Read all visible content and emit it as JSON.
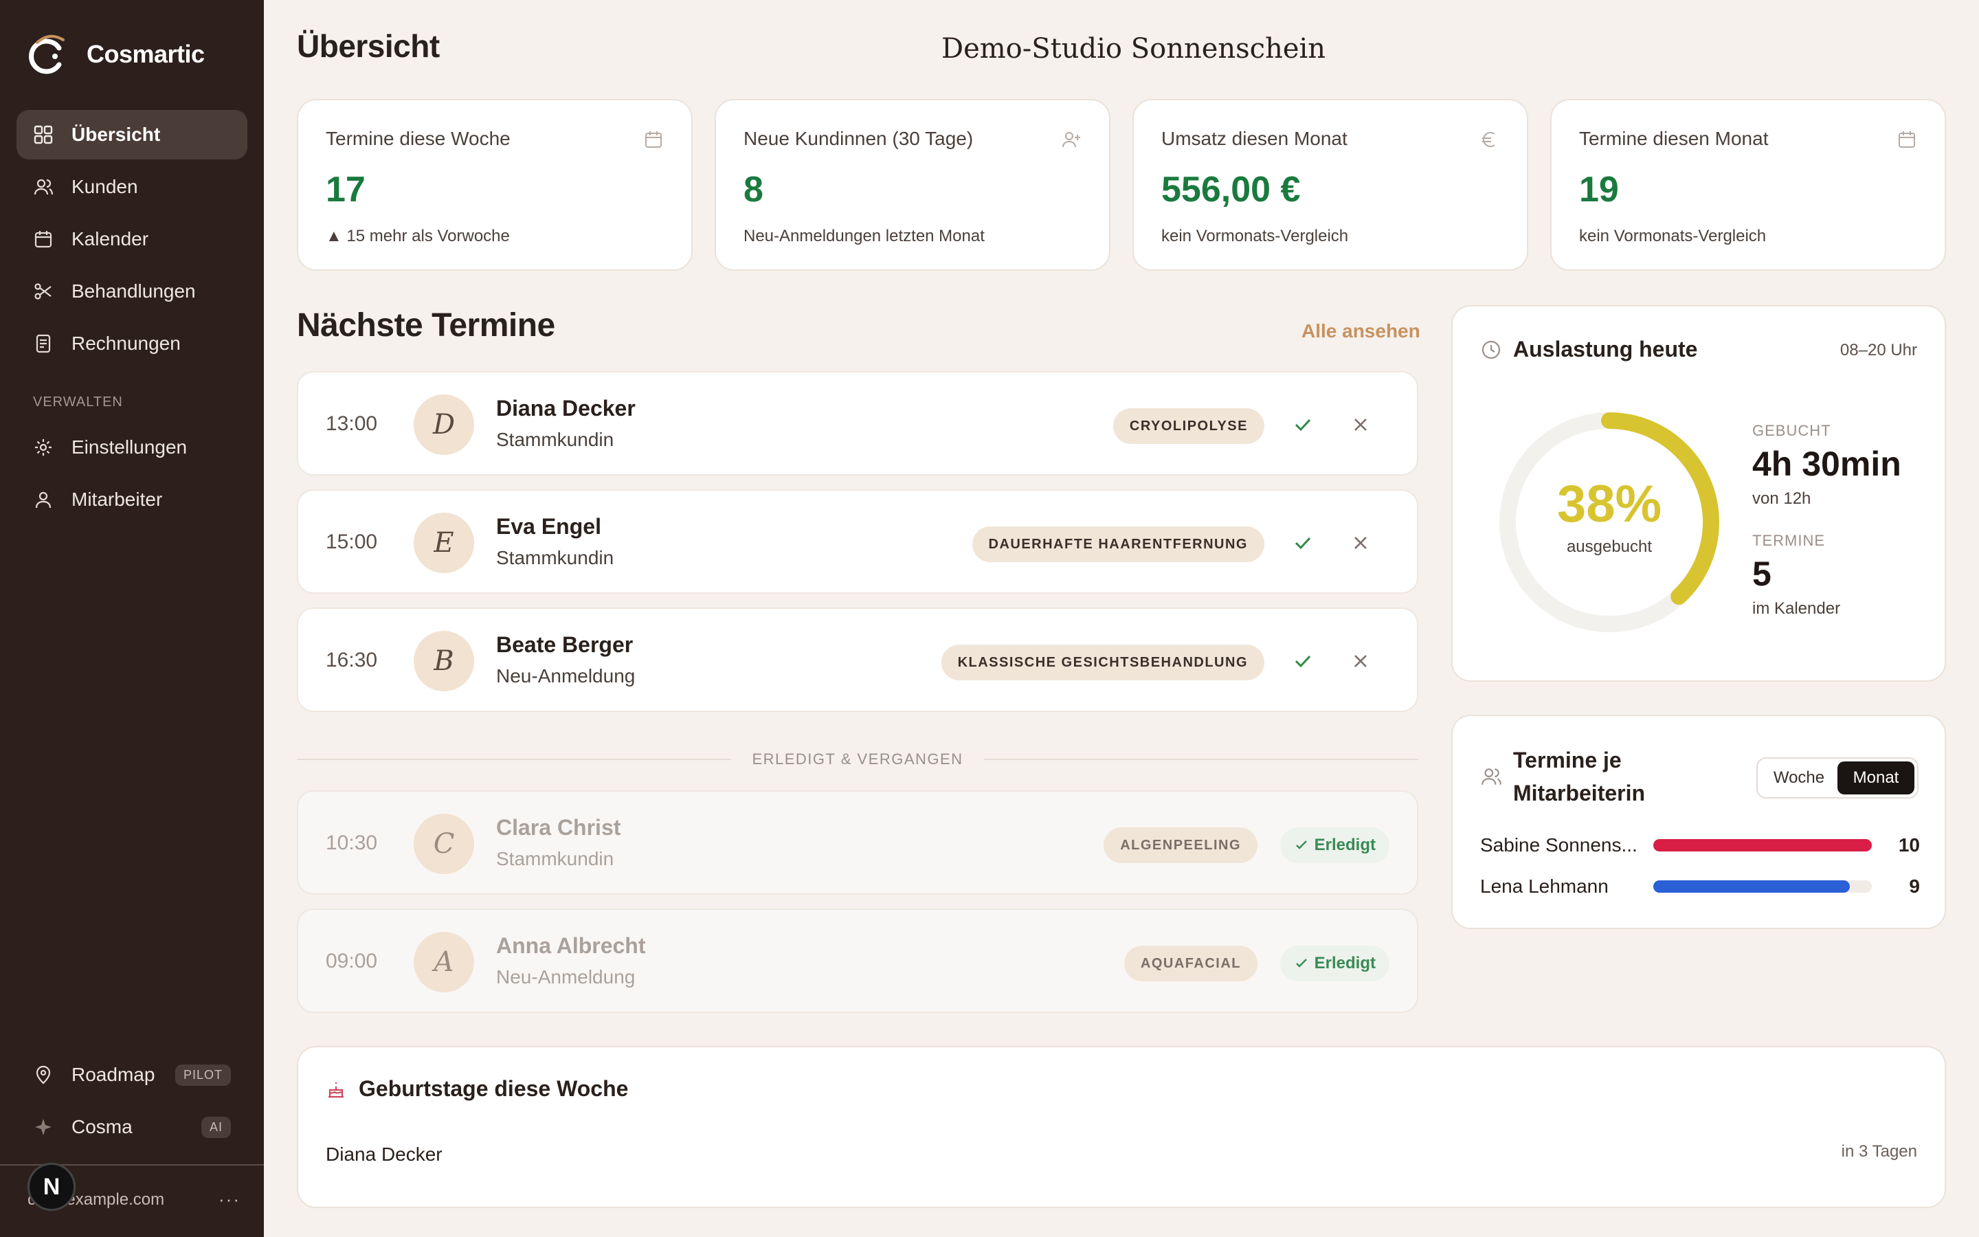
{
  "brand": {
    "name": "Cosmartic"
  },
  "nav": {
    "items": [
      {
        "label": "Übersicht",
        "icon": "grid-icon"
      },
      {
        "label": "Kunden",
        "icon": "users-icon"
      },
      {
        "label": "Kalender",
        "icon": "calendar-icon"
      },
      {
        "label": "Behandlungen",
        "icon": "scissors-icon"
      },
      {
        "label": "Rechnungen",
        "icon": "receipt-icon"
      }
    ],
    "section_label": "VERWALTEN",
    "manage": [
      {
        "label": "Einstellungen",
        "icon": "gear-icon"
      },
      {
        "label": "Mitarbeiter",
        "icon": "user-icon"
      }
    ],
    "bottom": [
      {
        "label": "Roadmap",
        "badge": "PILOT",
        "icon": "map-pin-icon"
      },
      {
        "label": "Cosma",
        "badge": "AI",
        "icon": "sparkle-icon"
      }
    ]
  },
  "user": {
    "email": "c...@example.com",
    "more": "···",
    "n_badge": "N"
  },
  "header": {
    "title": "Übersicht",
    "studio": "Demo-Studio Sonnenschein"
  },
  "stats": [
    {
      "label": "Termine diese Woche",
      "value": "17",
      "sub": "▲ 15 mehr als Vorwoche",
      "icon": "calendar-icon"
    },
    {
      "label": "Neue Kundinnen (30 Tage)",
      "value": "8",
      "sub": "Neu-Anmeldungen letzten Monat",
      "icon": "user-plus-icon"
    },
    {
      "label": "Umsatz diesen Monat",
      "value": "556,00 €",
      "sub": "kein Vormonats-Vergleich",
      "icon": "euro-icon"
    },
    {
      "label": "Termine diesen Monat",
      "value": "19",
      "sub": "kein Vormonats-Vergleich",
      "icon": "calendar-icon"
    }
  ],
  "upcoming": {
    "title": "Nächste Termine",
    "see_all": "Alle ansehen",
    "items": [
      {
        "time": "13:00",
        "initial": "D",
        "name": "Diana Decker",
        "status": "Stammkundin",
        "treatment": "CRYOLIPOLYSE"
      },
      {
        "time": "15:00",
        "initial": "E",
        "name": "Eva Engel",
        "status": "Stammkundin",
        "treatment": "DAUERHAFTE HAARENTFERNUNG"
      },
      {
        "time": "16:30",
        "initial": "B",
        "name": "Beate Berger",
        "status": "Neu-Anmeldung",
        "treatment": "KLASSISCHE GESICHTSBEHANDLUNG"
      }
    ],
    "past_label": "ERLEDIGT & VERGANGEN",
    "past": [
      {
        "time": "10:30",
        "initial": "C",
        "name": "Clara Christ",
        "status": "Stammkundin",
        "treatment": "ALGENPEELING",
        "done": "Erledigt"
      },
      {
        "time": "09:00",
        "initial": "A",
        "name": "Anna Albrecht",
        "status": "Neu-Anmeldung",
        "treatment": "AQUAFACIAL",
        "done": "Erledigt"
      }
    ]
  },
  "utilization": {
    "title": "Auslastung heute",
    "hours": "08–20 Uhr",
    "percent": 38,
    "percent_label": "38%",
    "sub": "ausgebucht",
    "booked_label": "GEBUCHT",
    "booked_value": "4h 30min",
    "booked_sub": "von 12h",
    "appts_label": "TERMINE",
    "appts_value": "5",
    "appts_sub": "im Kalender",
    "accent": "#d8c430"
  },
  "staff": {
    "title_line1": "Termine je",
    "title_line2": "Mitarbeiterin",
    "toggle": {
      "week": "Woche",
      "month": "Monat"
    },
    "max": 10,
    "rows": [
      {
        "name": "Sabine Sonnens...",
        "value": 10,
        "value_label": "10",
        "color": "#d81e45"
      },
      {
        "name": "Lena Lehmann",
        "value": 9,
        "value_label": "9",
        "color": "#2a5fd6"
      }
    ]
  },
  "birthdays": {
    "title": "Geburtstage diese Woche",
    "items": [
      {
        "name": "Diana Decker",
        "when": "in 3 Tagen"
      }
    ]
  }
}
